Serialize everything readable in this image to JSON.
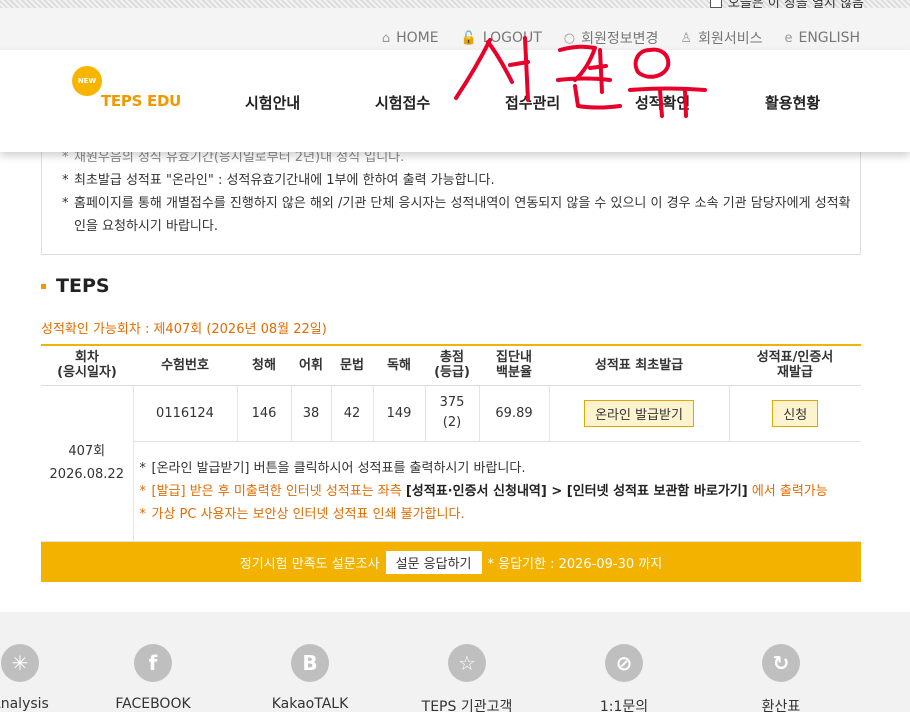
{
  "popup": {
    "label": "오늘은 이 창을 열지 않음"
  },
  "util_nav": [
    {
      "icon": "home-icon",
      "glyph": "⌂",
      "label": "HOME"
    },
    {
      "icon": "lock-icon",
      "glyph": "🔓",
      "label": "LOGOUT"
    },
    {
      "icon": "search-icon",
      "glyph": "○",
      "label": "회원정보변경"
    },
    {
      "icon": "user-icon",
      "glyph": "♙",
      "label": "회원서비스"
    },
    {
      "icon": "language-icon",
      "glyph": "e",
      "label": "ENGLISH"
    }
  ],
  "logo": {
    "badge": "NEW",
    "text": "TEPS EDU"
  },
  "gnb": [
    "시험안내",
    "시험접수",
    "접수관리",
    "성적확인",
    "활용현황"
  ],
  "info_lines": [
    "재원우음의 정식 유효기간(응시일로부터 2년)내 정식 입니다.",
    "최초발급 성적표 \"온라인\" : 성적유효기간내에 1부에 한하여 출력 가능합니다.",
    "홈페이지를 통해 개별접수를 진행하지 않은 해외 /기관 단체 응시자는 성적내역이 연동되지 않을 수 있으니 이 경우 소속 기관 담당자에게 성적확인을 요청하시기 바랍니다."
  ],
  "section_title": "TEPS",
  "available_round": "성적확인 가능회차 : 제407회 (2026년 08월 22일)",
  "table": {
    "headers": {
      "round": "회차\n(응시일자)",
      "exam_no": "수험번호",
      "listening": "청해",
      "vocab": "어휘",
      "grammar": "문법",
      "reading": "독해",
      "total": "총점\n(등급)",
      "percentile": "집단내\n백분율",
      "first_issue": "성적표 최초발급",
      "reissue": "성적표/인증서\n재발급"
    },
    "row": {
      "round": "407회",
      "date": "2026.08.22",
      "exam_no": "0116124",
      "listening": "146",
      "vocab": "38",
      "grammar": "42",
      "reading": "149",
      "total": "375",
      "grade": "(2)",
      "percentile": "69.89",
      "first_issue_btn": "온라인 발급받기",
      "reissue_btn": "신청"
    },
    "notes": {
      "n1": "[온라인 발급받기] 버튼을 클릭하시어 성적표를 출력하시기 바랍니다.",
      "n2a": "[발급] 받은 후 미출력한 인터넷 성적표는 좌측 ",
      "n2b": "[성적표·인증서 신청내역] > [인터넷 성적표 보관함 바로가기]",
      "n2c": " 에서 출력가능",
      "n3": "가상 PC 사용자는 보안상 인터넷 성적표 인쇄 불가합니다."
    }
  },
  "survey": {
    "label": "정기시험 만족도 설문조사",
    "button": "설문 응답하기",
    "deadline": "* 응답기한 : 2026-09-30 까지"
  },
  "footer": [
    {
      "icon": "analysis-icon",
      "glyph": "✳",
      "label": "Analysis"
    },
    {
      "icon": "facebook-icon",
      "glyph": "f",
      "label": "FACEBOOK"
    },
    {
      "icon": "kakaotalk-icon",
      "glyph": "B",
      "label": "KakaoTALK"
    },
    {
      "icon": "star-icon",
      "glyph": "☆",
      "label": "TEPS 기관고객"
    },
    {
      "icon": "inquiry-icon",
      "glyph": "⊘",
      "label": "1:1문의"
    },
    {
      "icon": "refresh-icon",
      "glyph": "↻",
      "label": "환산표"
    }
  ],
  "colors": {
    "accent": "#f3b200",
    "orange_text": "#e46b00",
    "scribble": "#e8002a"
  }
}
